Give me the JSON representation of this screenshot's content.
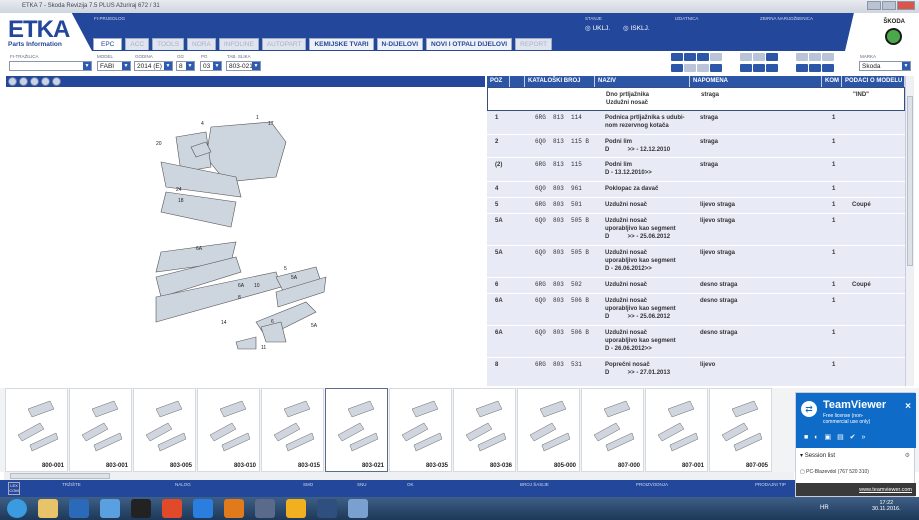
{
  "window": {
    "title": "ETKA 7 - Skoda Revizija 7.5 PLUS Ažuriraj 672 / 31"
  },
  "logo": {
    "name": "ETKA",
    "tagline": "Parts Information"
  },
  "brand": {
    "name": "ŠKODA",
    "color": "#4aa84a"
  },
  "header": {
    "fi_prijedlog": "FI-PRIJEDLOG",
    "stanje": "STANJE",
    "ukl": "UKLJ.",
    "iskl": "ISKLJ.",
    "izdatnica": "IZDATNICA",
    "zbirna": "ZBIRNA NARUDŽBENICA",
    "accent": "#23479a"
  },
  "tabs": [
    {
      "label": "EPC",
      "state": "active"
    },
    {
      "label": "ACC",
      "state": "disabled"
    },
    {
      "label": "TOOLS",
      "state": "disabled"
    },
    {
      "label": "NORA",
      "state": "disabled"
    },
    {
      "label": "INFOLINE",
      "state": "disabled"
    },
    {
      "label": "AUTOPART",
      "state": "disabled"
    },
    {
      "label": "KEMIJSKE TVARI",
      "state": "enabled"
    },
    {
      "label": "N-DIJELOVI",
      "state": "enabled"
    },
    {
      "label": "NOVI I OTPALI DIJELOVI",
      "state": "enabled"
    },
    {
      "label": "REPORT",
      "state": "disabled"
    }
  ],
  "filters": {
    "fi_trazilica": {
      "label": "FI-TRAŽILICA",
      "value": ""
    },
    "model": {
      "label": "MODEL",
      "value": "FABI"
    },
    "godina": {
      "label": "GODINA",
      "value": "2014 (E)"
    },
    "gg": {
      "label": "GG",
      "value": "8"
    },
    "pg": {
      "label": "PG",
      "value": "03"
    },
    "tab_slika": {
      "label": "TAB. SLIKA",
      "value": "803-021"
    },
    "marka": {
      "label": "MARKA",
      "value": "Skoda"
    }
  },
  "table": {
    "columns": [
      "POZ",
      "",
      "KATALOŠKI BROJ",
      "NAZIV",
      "NAPOMENA",
      "KOM",
      "PODACI O MODELU"
    ],
    "rows": [
      {
        "poz": "",
        "kat": "",
        "naziv": "Dno prtljažnika\nUzdužni nosač",
        "napomena": "straga",
        "kom": "",
        "podaci": "\"IND\"",
        "selected": true
      },
      {
        "poz": "1",
        "kat": "6RG  813  114",
        "naziv": "Podnica prtljažnika s udubi-\nnom rezervnog kotača",
        "napomena": "straga",
        "kom": "1",
        "podaci": ""
      },
      {
        "poz": "2",
        "kat": "6Q0  813  115 B",
        "naziv": "Podni lim\nD           >> - 12.12.2010",
        "napomena": "straga",
        "kom": "1",
        "podaci": ""
      },
      {
        "poz": "(2)",
        "kat": "6RG  813  115",
        "naziv": "Podni lim\nD - 13.12.2010>>",
        "napomena": "straga",
        "kom": "1",
        "podaci": ""
      },
      {
        "poz": "4",
        "kat": "6Q0  803  961",
        "naziv": "Poklopac za davač",
        "napomena": "",
        "kom": "1",
        "podaci": ""
      },
      {
        "poz": "5",
        "kat": "6RG  803  501",
        "naziv": "Uzdužni nosač",
        "napomena": "lijevo straga",
        "kom": "1",
        "podaci": "Coupé"
      },
      {
        "poz": "5A",
        "kat": "6Q0  803  505 B",
        "naziv": "Uzdužni nosač\nuporabljivo kao segment\nD           >> - 25.06.2012",
        "napomena": "lijevo straga",
        "kom": "1",
        "podaci": ""
      },
      {
        "poz": "5A",
        "kat": "6Q0  803  505 B",
        "naziv": "Uzdužni nosač\nuporabljivo kao segment\nD - 26.06.2012>>",
        "napomena": "lijevo straga",
        "kom": "1",
        "podaci": ""
      },
      {
        "poz": "6",
        "kat": "6RG  803  502",
        "naziv": "Uzdužni nosač",
        "napomena": "desno straga",
        "kom": "1",
        "podaci": "Coupé"
      },
      {
        "poz": "6A",
        "kat": "6Q0  803  506 B",
        "naziv": "Uzdužni nosač\nuporabljivo kao segment\nD           >> - 25.06.2012",
        "napomena": "desno straga",
        "kom": "1",
        "podaci": ""
      },
      {
        "poz": "6A",
        "kat": "6Q0  803  506 B",
        "naziv": "Uzdužni nosač\nuporabljivo kao segment\nD - 26.06.2012>>",
        "napomena": "desno straga",
        "kom": "1",
        "podaci": ""
      },
      {
        "poz": "8",
        "kat": "6RG  803  531",
        "naziv": "Poprečni nosač\nD           >> - 27.01.2013",
        "napomena": "lijevo",
        "kom": "1",
        "podaci": ""
      }
    ]
  },
  "diagram": {
    "callouts": [
      "1",
      "17",
      "4",
      "20",
      "24",
      "18",
      "6A",
      "5",
      "5A",
      "6A",
      "10",
      "8",
      "14",
      "11",
      "6",
      "5A"
    ]
  },
  "thumbnails": [
    {
      "label": "800-001"
    },
    {
      "label": "803-001"
    },
    {
      "label": "803-005"
    },
    {
      "label": "803-010"
    },
    {
      "label": "803-015"
    },
    {
      "label": "803-021",
      "selected": true
    },
    {
      "label": "803-035"
    },
    {
      "label": "803-036"
    },
    {
      "label": "805-000"
    },
    {
      "label": "807-000"
    },
    {
      "label": "807-001"
    },
    {
      "label": "807-005"
    }
  ],
  "statusbar": {
    "lexcom": "LEX COM",
    "fields": [
      "TRŽIŠTE",
      "NALOG",
      "SMO",
      "SNU",
      "OK",
      "BROJ ŠASIJE",
      "PROIZVODNJA",
      "PRODAJNI TIP"
    ]
  },
  "teamviewer": {
    "title": "TeamViewer",
    "license": "Free license (non-commercial use only)",
    "session_list": "Session list",
    "session": "PC-Blazevdol (767 520 310)",
    "link": "www.teamviewer.com"
  },
  "taskbar": {
    "language": "HR",
    "time": "17:22",
    "date": "30.11.2016."
  }
}
